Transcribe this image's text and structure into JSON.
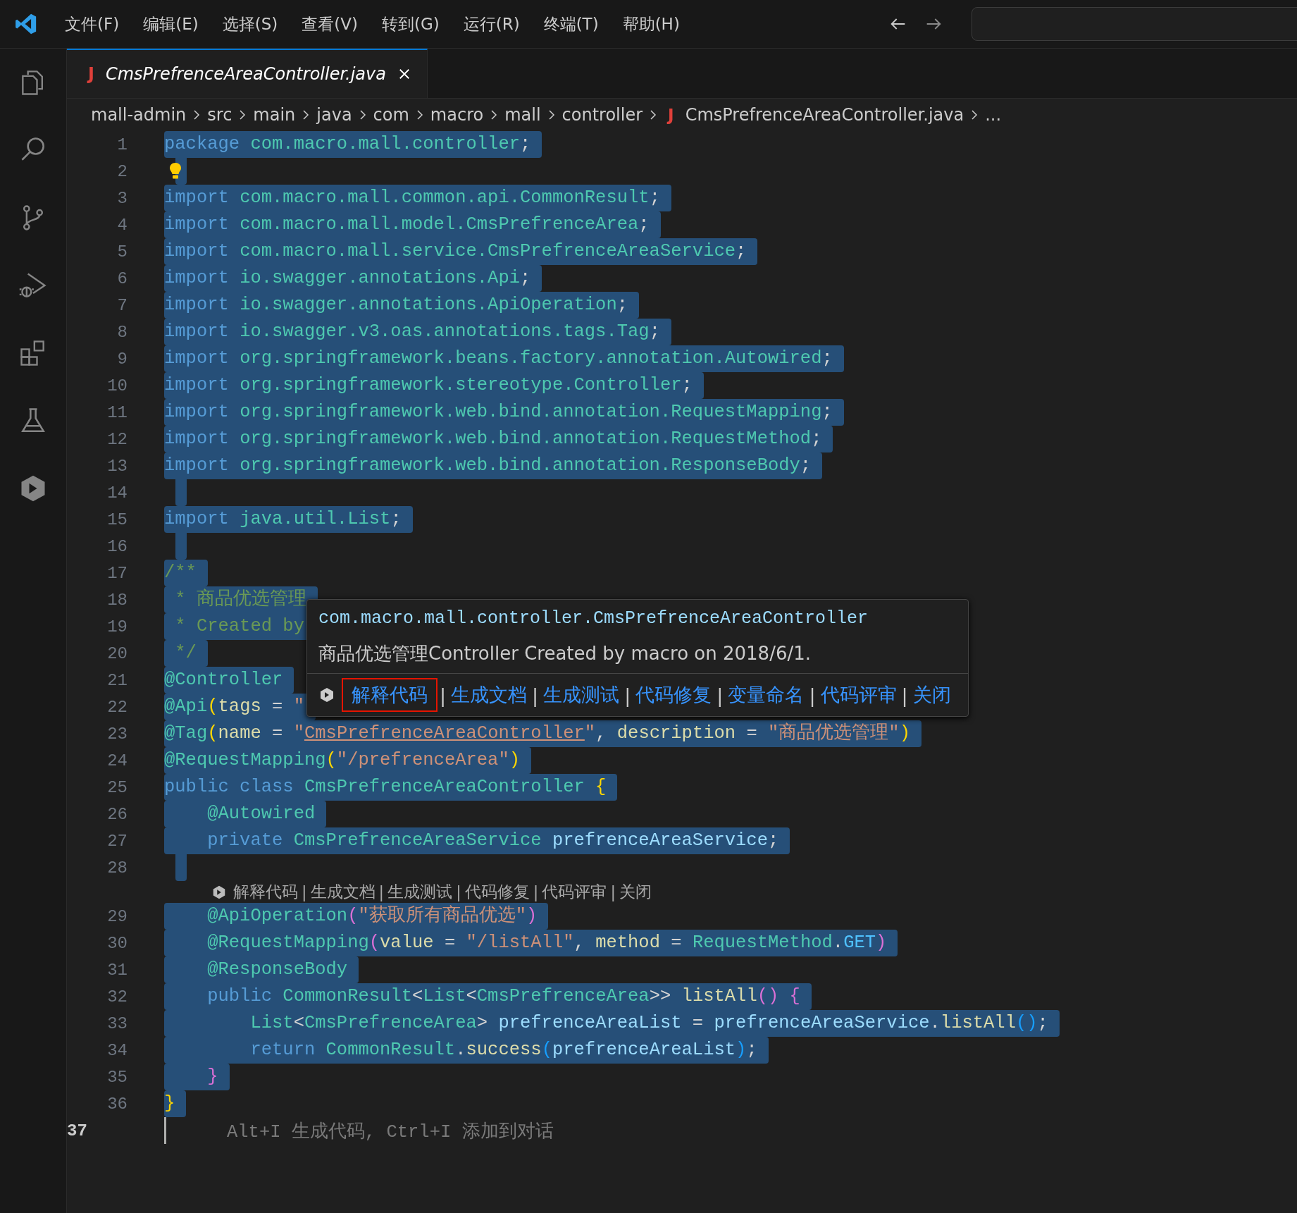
{
  "menu": [
    {
      "label": "文件(F)"
    },
    {
      "label": "编辑(E)"
    },
    {
      "label": "选择(S)"
    },
    {
      "label": "查看(V)"
    },
    {
      "label": "转到(G)"
    },
    {
      "label": "运行(R)"
    },
    {
      "label": "终端(T)"
    },
    {
      "label": "帮助(H)"
    }
  ],
  "activity_bar": [
    {
      "kind": "files",
      "selected": false
    },
    {
      "kind": "search",
      "selected": false
    },
    {
      "kind": "source-control",
      "selected": false
    },
    {
      "kind": "run-debug",
      "selected": false
    },
    {
      "kind": "extensions",
      "selected": false
    },
    {
      "kind": "testing",
      "selected": false
    },
    {
      "kind": "assistant",
      "selected": false
    }
  ],
  "tabs": [
    {
      "icon_glyph": "J",
      "label": "CmsPrefrenceAreaController.java",
      "selected": true
    }
  ],
  "breadcrumb": [
    {
      "label": "mall-admin"
    },
    {
      "label": "src"
    },
    {
      "label": "main"
    },
    {
      "label": "java"
    },
    {
      "label": "com"
    },
    {
      "label": "macro"
    },
    {
      "label": "mall"
    },
    {
      "label": "controller"
    },
    {
      "label": "CmsPrefrenceAreaController.java",
      "icon_glyph": "J"
    },
    {
      "label": "..."
    }
  ],
  "lines": [
    {
      "kind": "code",
      "number": "1",
      "selected": true,
      "active": false,
      "tokens": [
        {
          "t": "package ",
          "color": "#569cd6"
        },
        {
          "t": "com.macro.mall.controller",
          "color": "#4ec9b0"
        },
        {
          "t": ";",
          "color": "#d4d4d4"
        }
      ]
    },
    {
      "kind": "code",
      "number": "2",
      "selected": true,
      "active": false,
      "lightbulb": true
    },
    {
      "kind": "code",
      "number": "3",
      "selected": true,
      "active": false,
      "tokens": [
        {
          "t": "import ",
          "color": "#569cd6"
        },
        {
          "t": "com.macro.mall.common.api.CommonResult",
          "color": "#4ec9b0"
        },
        {
          "t": ";",
          "color": "#d4d4d4"
        }
      ]
    },
    {
      "kind": "code",
      "number": "4",
      "selected": true,
      "active": false,
      "tokens": [
        {
          "t": "import ",
          "color": "#569cd6"
        },
        {
          "t": "com.macro.mall.model.CmsPrefrenceArea",
          "color": "#4ec9b0"
        },
        {
          "t": ";",
          "color": "#d4d4d4"
        }
      ]
    },
    {
      "kind": "code",
      "number": "5",
      "selected": true,
      "active": false,
      "tokens": [
        {
          "t": "import ",
          "color": "#569cd6"
        },
        {
          "t": "com.macro.mall.service.CmsPrefrenceAreaService",
          "color": "#4ec9b0"
        },
        {
          "t": ";",
          "color": "#d4d4d4"
        }
      ]
    },
    {
      "kind": "code",
      "number": "6",
      "selected": true,
      "active": false,
      "tokens": [
        {
          "t": "import ",
          "color": "#569cd6"
        },
        {
          "t": "io.swagger.annotations.Api",
          "color": "#4ec9b0"
        },
        {
          "t": ";",
          "color": "#d4d4d4"
        }
      ]
    },
    {
      "kind": "code",
      "number": "7",
      "selected": true,
      "active": false,
      "tokens": [
        {
          "t": "import ",
          "color": "#569cd6"
        },
        {
          "t": "io.swagger.annotations.ApiOperation",
          "color": "#4ec9b0"
        },
        {
          "t": ";",
          "color": "#d4d4d4"
        }
      ]
    },
    {
      "kind": "code",
      "number": "8",
      "selected": true,
      "active": false,
      "tokens": [
        {
          "t": "import ",
          "color": "#569cd6"
        },
        {
          "t": "io.swagger.v3.oas.annotations.tags.Tag",
          "color": "#4ec9b0"
        },
        {
          "t": ";",
          "color": "#d4d4d4"
        }
      ]
    },
    {
      "kind": "code",
      "number": "9",
      "selected": true,
      "active": false,
      "tokens": [
        {
          "t": "import ",
          "color": "#569cd6"
        },
        {
          "t": "org.springframework.beans.factory.annotation.Autowired",
          "color": "#4ec9b0"
        },
        {
          "t": ";",
          "color": "#d4d4d4"
        }
      ]
    },
    {
      "kind": "code",
      "number": "10",
      "selected": true,
      "active": false,
      "tokens": [
        {
          "t": "import ",
          "color": "#569cd6"
        },
        {
          "t": "org.springframework.stereotype.Controller",
          "color": "#4ec9b0"
        },
        {
          "t": ";",
          "color": "#d4d4d4"
        }
      ]
    },
    {
      "kind": "code",
      "number": "11",
      "selected": true,
      "active": false,
      "tokens": [
        {
          "t": "import ",
          "color": "#569cd6"
        },
        {
          "t": "org.springframework.web.bind.annotation.RequestMapping",
          "color": "#4ec9b0"
        },
        {
          "t": ";",
          "color": "#d4d4d4"
        }
      ]
    },
    {
      "kind": "code",
      "number": "12",
      "selected": true,
      "active": false,
      "tokens": [
        {
          "t": "import ",
          "color": "#569cd6"
        },
        {
          "t": "org.springframework.web.bind.annotation.RequestMethod",
          "color": "#4ec9b0"
        },
        {
          "t": ";",
          "color": "#d4d4d4"
        }
      ]
    },
    {
      "kind": "code",
      "number": "13",
      "selected": true,
      "active": false,
      "tokens": [
        {
          "t": "import ",
          "color": "#569cd6"
        },
        {
          "t": "org.springframework.web.bind.annotation.ResponseBody",
          "color": "#4ec9b0"
        },
        {
          "t": ";",
          "color": "#d4d4d4"
        }
      ]
    },
    {
      "kind": "code",
      "number": "14",
      "selected": true,
      "active": false
    },
    {
      "kind": "code",
      "number": "15",
      "selected": true,
      "active": false,
      "tokens": [
        {
          "t": "import ",
          "color": "#569cd6"
        },
        {
          "t": "java.util.List",
          "color": "#4ec9b0"
        },
        {
          "t": ";",
          "color": "#d4d4d4"
        }
      ]
    },
    {
      "kind": "code",
      "number": "16",
      "selected": true,
      "active": false
    },
    {
      "kind": "code",
      "number": "17",
      "selected": true,
      "active": false,
      "tokens": [
        {
          "t": "/**",
          "color": "#6a9955"
        }
      ]
    },
    {
      "kind": "code",
      "number": "18",
      "selected": true,
      "active": false,
      "tokens": [
        {
          "t": " * 商品优选管理",
          "color": "#6a9955"
        }
      ]
    },
    {
      "kind": "code",
      "number": "19",
      "selected": true,
      "active": false,
      "tokens": [
        {
          "t": " * Created by",
          "color": "#6a9955"
        }
      ]
    },
    {
      "kind": "code",
      "number": "20",
      "selected": true,
      "active": false,
      "tokens": [
        {
          "t": " */",
          "color": "#6a9955"
        }
      ]
    },
    {
      "kind": "code",
      "number": "21",
      "selected": true,
      "active": false,
      "tokens": [
        {
          "t": "@Controller",
          "color": "#4ec9b0"
        }
      ]
    },
    {
      "kind": "code",
      "number": "22",
      "selected": true,
      "active": false,
      "tokens": [
        {
          "t": "@Api",
          "color": "#4ec9b0"
        },
        {
          "t": "(",
          "color": "#ffd700"
        },
        {
          "t": "tags",
          "color": "#dcdcaa"
        },
        {
          "t": " = ",
          "color": "#d4d4d4"
        },
        {
          "t": "\"",
          "color": "#ce9178"
        }
      ]
    },
    {
      "kind": "code",
      "number": "23",
      "selected": true,
      "active": false,
      "tokens": [
        {
          "t": "@Tag",
          "color": "#4ec9b0"
        },
        {
          "t": "(",
          "color": "#ffd700"
        },
        {
          "t": "name",
          "color": "#dcdcaa"
        },
        {
          "t": " = ",
          "color": "#d4d4d4"
        },
        {
          "t": "\"",
          "color": "#ce9178"
        },
        {
          "t": "CmsPrefrenceAreaController",
          "color": "#ce9178",
          "link": true
        },
        {
          "t": "\"",
          "color": "#ce9178"
        },
        {
          "t": ", ",
          "color": "#d4d4d4"
        },
        {
          "t": "description",
          "color": "#dcdcaa"
        },
        {
          "t": " = ",
          "color": "#d4d4d4"
        },
        {
          "t": "\"商品优选管理\"",
          "color": "#ce9178"
        },
        {
          "t": ")",
          "color": "#ffd700"
        }
      ]
    },
    {
      "kind": "code",
      "number": "24",
      "selected": true,
      "active": false,
      "tokens": [
        {
          "t": "@RequestMapping",
          "color": "#4ec9b0"
        },
        {
          "t": "(",
          "color": "#ffd700"
        },
        {
          "t": "\"/prefrenceArea\"",
          "color": "#ce9178"
        },
        {
          "t": ")",
          "color": "#ffd700"
        }
      ]
    },
    {
      "kind": "code",
      "number": "25",
      "selected": true,
      "active": false,
      "tokens": [
        {
          "t": "public class ",
          "color": "#569cd6"
        },
        {
          "t": "CmsPrefrenceAreaController ",
          "color": "#4ec9b0"
        },
        {
          "t": "{",
          "color": "#ffd700"
        }
      ]
    },
    {
      "kind": "code",
      "number": "26",
      "selected": true,
      "active": false,
      "tokens": [
        {
          "t": "    @Autowired",
          "color": "#4ec9b0"
        }
      ]
    },
    {
      "kind": "code",
      "number": "27",
      "selected": true,
      "active": false,
      "tokens": [
        {
          "t": "    private ",
          "color": "#569cd6"
        },
        {
          "t": "CmsPrefrenceAreaService ",
          "color": "#4ec9b0"
        },
        {
          "t": "prefrenceAreaService",
          "color": "#9cdcfe"
        },
        {
          "t": ";",
          "color": "#d4d4d4"
        }
      ]
    },
    {
      "kind": "code",
      "number": "28",
      "selected": true,
      "active": false
    },
    {
      "kind": "codelens",
      "separator": "|",
      "items": [
        "解释代码",
        "生成文档",
        "生成测试",
        "代码修复",
        "代码评审",
        "关闭"
      ]
    },
    {
      "kind": "code",
      "number": "29",
      "selected": true,
      "active": false,
      "tokens": [
        {
          "t": "    @ApiOperation",
          "color": "#4ec9b0"
        },
        {
          "t": "(",
          "color": "#da70d6"
        },
        {
          "t": "\"获取所有商品优选\"",
          "color": "#ce9178"
        },
        {
          "t": ")",
          "color": "#da70d6"
        }
      ]
    },
    {
      "kind": "code",
      "number": "30",
      "selected": true,
      "active": false,
      "tokens": [
        {
          "t": "    @RequestMapping",
          "color": "#4ec9b0"
        },
        {
          "t": "(",
          "color": "#da70d6"
        },
        {
          "t": "value",
          "color": "#dcdcaa"
        },
        {
          "t": " = ",
          "color": "#d4d4d4"
        },
        {
          "t": "\"/listAll\"",
          "color": "#ce9178"
        },
        {
          "t": ", ",
          "color": "#d4d4d4"
        },
        {
          "t": "method",
          "color": "#dcdcaa"
        },
        {
          "t": " = ",
          "color": "#d4d4d4"
        },
        {
          "t": "RequestMethod",
          "color": "#4ec9b0"
        },
        {
          "t": ".",
          "color": "#d4d4d4"
        },
        {
          "t": "GET",
          "color": "#4fc1ff"
        },
        {
          "t": ")",
          "color": "#da70d6"
        }
      ]
    },
    {
      "kind": "code",
      "number": "31",
      "selected": true,
      "active": false,
      "tokens": [
        {
          "t": "    @ResponseBody",
          "color": "#4ec9b0"
        }
      ]
    },
    {
      "kind": "code",
      "number": "32",
      "selected": true,
      "active": false,
      "tokens": [
        {
          "t": "    public ",
          "color": "#569cd6"
        },
        {
          "t": "CommonResult",
          "color": "#4ec9b0"
        },
        {
          "t": "<",
          "color": "#d4d4d4"
        },
        {
          "t": "List",
          "color": "#4ec9b0"
        },
        {
          "t": "<",
          "color": "#d4d4d4"
        },
        {
          "t": "CmsPrefrenceArea",
          "color": "#4ec9b0"
        },
        {
          "t": ">> ",
          "color": "#d4d4d4"
        },
        {
          "t": "listAll",
          "color": "#dcdcaa"
        },
        {
          "t": "() {",
          "color": "#da70d6"
        }
      ]
    },
    {
      "kind": "code",
      "number": "33",
      "selected": true,
      "active": false,
      "tokens": [
        {
          "t": "        List",
          "color": "#4ec9b0"
        },
        {
          "t": "<",
          "color": "#d4d4d4"
        },
        {
          "t": "CmsPrefrenceArea",
          "color": "#4ec9b0"
        },
        {
          "t": "> ",
          "color": "#d4d4d4"
        },
        {
          "t": "prefrenceAreaList",
          "color": "#9cdcfe"
        },
        {
          "t": " = ",
          "color": "#d4d4d4"
        },
        {
          "t": "prefrenceAreaService",
          "color": "#9cdcfe"
        },
        {
          "t": ".",
          "color": "#d4d4d4"
        },
        {
          "t": "listAll",
          "color": "#dcdcaa"
        },
        {
          "t": "()",
          "color": "#179fff"
        },
        {
          "t": ";",
          "color": "#d4d4d4"
        }
      ]
    },
    {
      "kind": "code",
      "number": "34",
      "selected": true,
      "active": false,
      "tokens": [
        {
          "t": "        return ",
          "color": "#569cd6"
        },
        {
          "t": "CommonResult",
          "color": "#4ec9b0"
        },
        {
          "t": ".",
          "color": "#d4d4d4"
        },
        {
          "t": "success",
          "color": "#dcdcaa"
        },
        {
          "t": "(",
          "color": "#179fff"
        },
        {
          "t": "prefrenceAreaList",
          "color": "#9cdcfe"
        },
        {
          "t": ")",
          "color": "#179fff"
        },
        {
          "t": ";",
          "color": "#d4d4d4"
        }
      ]
    },
    {
      "kind": "code",
      "number": "35",
      "selected": true,
      "active": false,
      "tokens": [
        {
          "t": "    }",
          "color": "#da70d6"
        }
      ]
    },
    {
      "kind": "code",
      "number": "36",
      "selected": true,
      "active": false,
      "tokens": [
        {
          "t": "}",
          "color": "#ffd700"
        }
      ]
    },
    {
      "kind": "code",
      "number": "37",
      "selected": false,
      "active": true,
      "hint": "Alt+I 生成代码, Ctrl+I 添加到对话"
    }
  ],
  "hover_popup": {
    "title": "com.macro.mall.controller.CmsPrefrenceAreaController",
    "description": "商品优选管理Controller Created by macro on 2018/6/1.",
    "separator": "|",
    "actions": [
      {
        "label": "解释代码",
        "selected": true
      },
      {
        "label": "生成文档",
        "selected": false
      },
      {
        "label": "生成测试",
        "selected": false
      },
      {
        "label": "代码修复",
        "selected": false
      },
      {
        "label": "变量命名",
        "selected": false
      },
      {
        "label": "代码评审",
        "selected": false
      },
      {
        "label": "关闭",
        "selected": false
      }
    ]
  }
}
